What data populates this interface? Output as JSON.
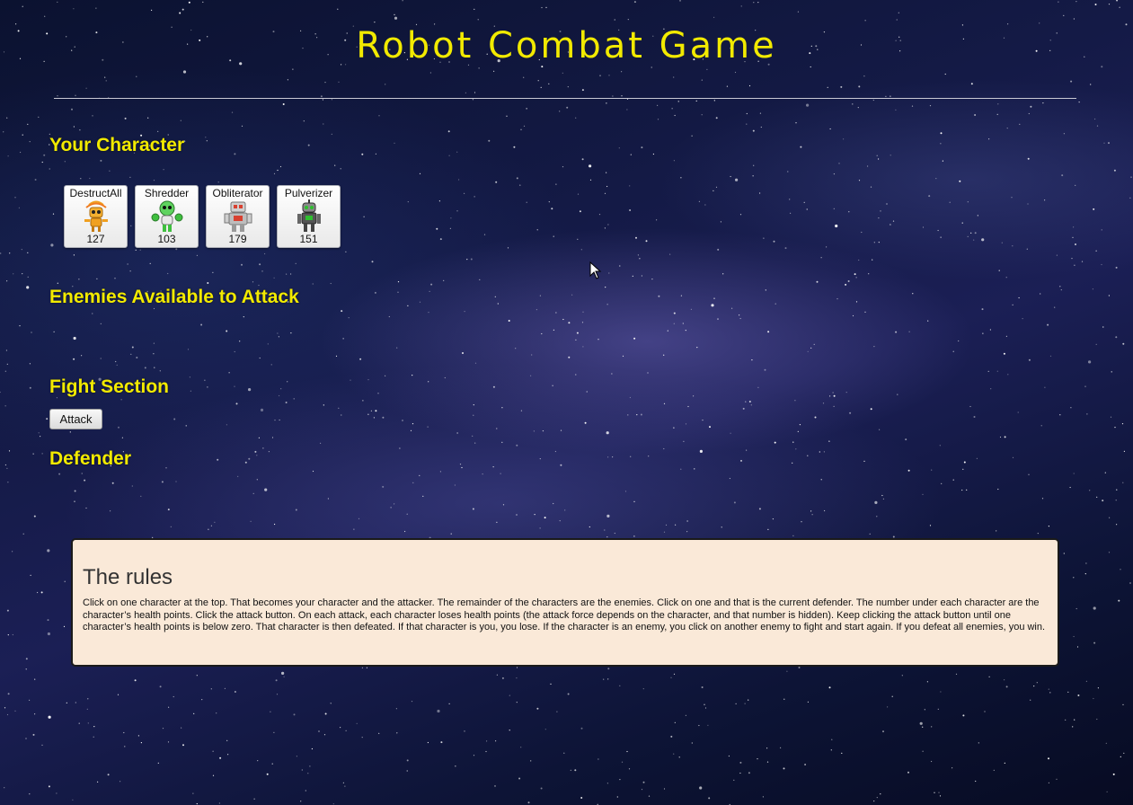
{
  "page": {
    "title": "Robot Combat Game",
    "background": "starry-galaxy"
  },
  "sections": {
    "your_character": "Your Character",
    "enemies": "Enemies Available to Attack",
    "fight": "Fight Section",
    "defender": "Defender"
  },
  "characters": [
    {
      "name": "DestructAll",
      "hp": "127",
      "icon": "orange-antenna-robot-icon",
      "color": "#f0a020"
    },
    {
      "name": "Shredder",
      "hp": "103",
      "icon": "green-robot-icon",
      "color": "#3fbf3f"
    },
    {
      "name": "Obliterator",
      "hp": "179",
      "icon": "grey-red-robot-icon",
      "color": "#d84030"
    },
    {
      "name": "Pulverizer",
      "hp": "151",
      "icon": "dark-grey-robot-icon",
      "color": "#555555"
    }
  ],
  "fight": {
    "attack_label": "Attack"
  },
  "rules": {
    "title": "The rules",
    "text": "Click on one character at the top. That becomes your character and the attacker. The remainder of the characters are the enemies. Click on one and that is the current defender. The number under each character are the character’s health points. Click the attack button. On each attack, each character loses health points (the attack force depends on the character, and that number is hidden). Keep clicking the attack button until one character’s health points is below zero. That character is then defeated. If that character is you, you lose. If the character is an enemy, you click on another enemy to fight and start again. If you defeat all enemies, you win."
  },
  "colors": {
    "heading": "#f2ea00",
    "rules_background": "#fae9d8"
  }
}
